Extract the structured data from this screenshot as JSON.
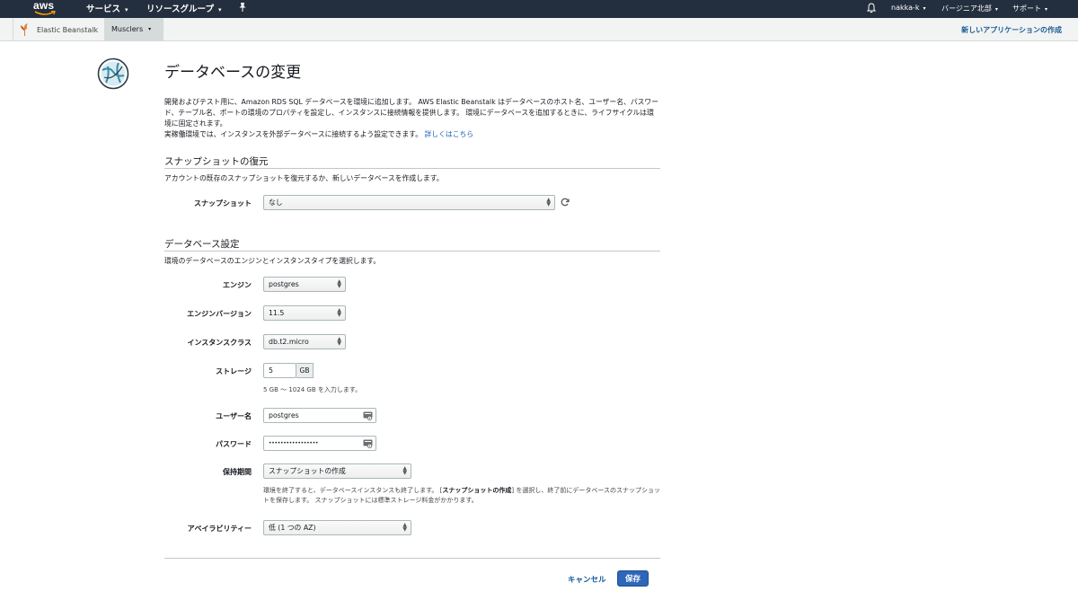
{
  "topnav": {
    "logo_text": "aws",
    "services_label": "サービス",
    "resource_groups_label": "リソースグループ",
    "pin_icon": "pin-icon",
    "bell_icon": "bell-icon",
    "account_label": "nakka-k",
    "region_label": "バージニア北部",
    "support_label": "サポート"
  },
  "service_bar": {
    "service_name": "Elastic Beanstalk",
    "application_name": "Musclers",
    "create_new_app": "新しいアプリケーションの作成"
  },
  "page": {
    "title": "データベースの変更",
    "intro_text": "開発およびテスト用に、Amazon RDS SQL データベースを環境に追加します。 AWS Elastic Beanstalk はデータベースのホスト名、ユーザー名、パスワード、テーブル名、ポートの環境のプロパティを設定し、インスタンスに接続情報を提供します。 環境にデータベースを追加するときに、ライフサイクルは環境に固定されます。",
    "intro_text_2": "実稼働環境では、インスタンスを外部データベースに接続するよう設定できます。",
    "learn_more": "詳しくはこちら"
  },
  "snapshot_section": {
    "title": "スナップショットの復元",
    "description": "アカウントの既存のスナップショットを復元するか、新しいデータベースを作成します。",
    "snapshot_label": "スナップショット",
    "snapshot_value": "なし"
  },
  "db_section": {
    "title": "データベース設定",
    "description": "環境のデータベースのエンジンとインスタンスタイプを選択します。",
    "engine_label": "エンジン",
    "engine_value": "postgres",
    "engine_version_label": "エンジンバージョン",
    "engine_version_value": "11.5",
    "instance_class_label": "インスタンスクラス",
    "instance_class_value": "db.t2.micro",
    "storage_label": "ストレージ",
    "storage_value": "5",
    "storage_unit": "GB",
    "storage_help": "5 GB 〜 1024 GB を入力します。",
    "username_label": "ユーザー名",
    "username_value": "postgres",
    "password_label": "パスワード",
    "password_value": "•••••••••••••••••",
    "retention_label": "保持期間",
    "retention_value": "スナップショットの作成",
    "retention_help_1": "環境を終了すると、データベースインスタンスも終了します。 [",
    "retention_help_bold": "スナップショットの作成",
    "retention_help_2": "] を選択し、終了前にデータベースのスナップショットを保存します。 スナップショットには標準ストレージ料金がかかります。",
    "availability_label": "アベイラビリティー",
    "availability_value": "低 (1 つの AZ)"
  },
  "actions": {
    "cancel_label": "キャンセル",
    "save_label": "保存"
  },
  "colors": {
    "navbar_bg": "#232f3e",
    "link_blue": "#1a5a96",
    "primary_button": "#2e66b8"
  }
}
